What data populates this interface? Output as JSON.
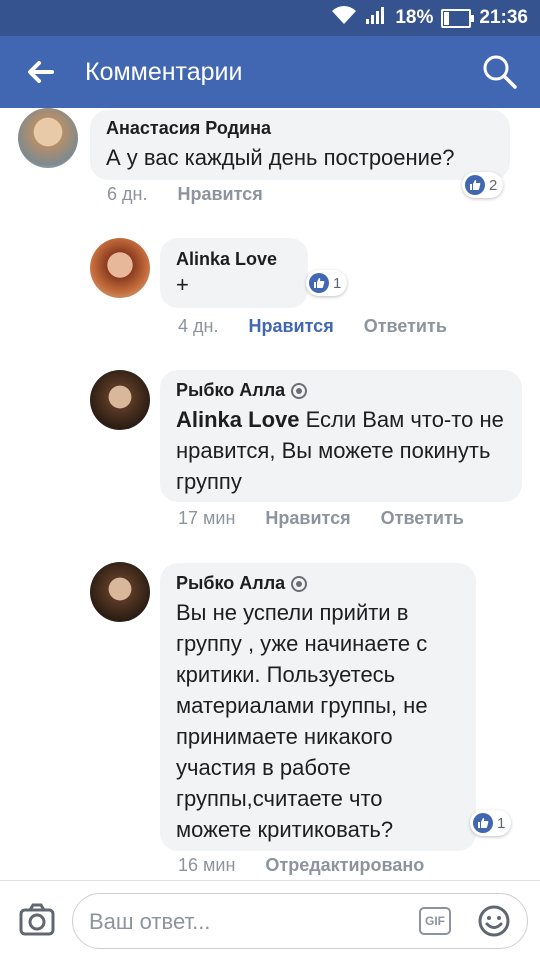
{
  "status_bar": {
    "battery": "18%",
    "time": "21:36"
  },
  "app_bar": {
    "title": "Комментарии",
    "back_icon": "arrow-left-icon",
    "search_icon": "search-icon"
  },
  "colors": {
    "header": "#4267b2",
    "status_bar": "#34538f",
    "bubble": "#f2f3f5",
    "like_active": "#4267b2"
  },
  "comments": [
    {
      "author": "Анастасия Родина",
      "text": "А у вас каждый день построение?",
      "time": "6 дн.",
      "like_label": "Нравится",
      "reaction_count": "2"
    },
    {
      "author": "Alinka Love",
      "text": "+",
      "time": "4 дн.",
      "like_label": "Нравится",
      "reply_label": "Ответить",
      "reaction_count": "1"
    },
    {
      "author": "Рыбко Алла",
      "mention": "Alinka Love",
      "text": " Если Вам что-то не нравится, Вы можете покинуть группу",
      "time": "17 мин",
      "like_label": "Нравится",
      "reply_label": "Ответить"
    },
    {
      "author": "Рыбко Алла",
      "text": "Вы не успели прийти в группу , уже начинаете с критики. Пользуетесь материалами группы, не принимаете никакого участия в работе группы,считаете что можете критиковать?",
      "time": "16 мин",
      "edited_label": "Отредактировано",
      "reaction_count": "1"
    }
  ],
  "composer": {
    "placeholder": "Ваш ответ...",
    "gif_label": "GIF"
  }
}
